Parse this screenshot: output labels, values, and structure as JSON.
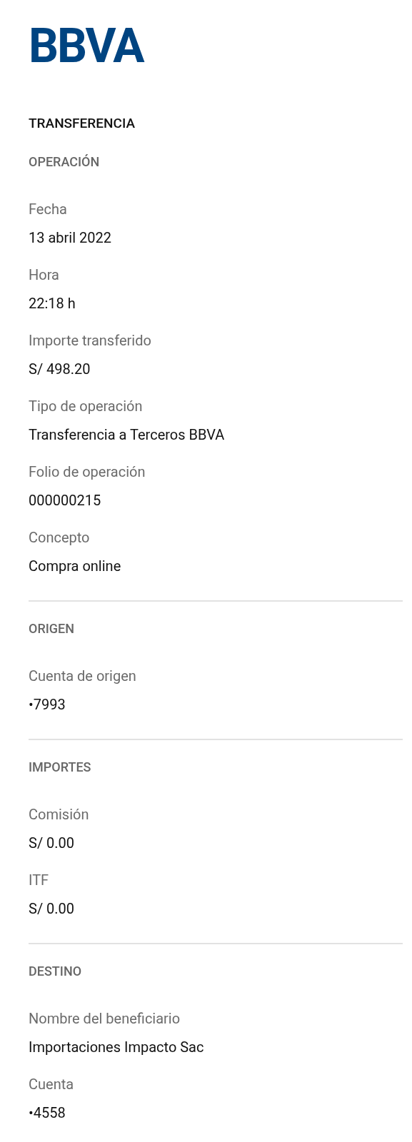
{
  "logo": {
    "text": "BBVA"
  },
  "title": "TRANSFERENCIA",
  "sections": [
    {
      "title": "OPERACIÓN",
      "fields": [
        {
          "label": "Fecha",
          "value": "13 abril 2022"
        },
        {
          "label": "Hora",
          "value": "22:18 h"
        },
        {
          "label": "Importe transferido",
          "value": "S/ 498.20"
        },
        {
          "label": "Tipo de operación",
          "value": "Transferencia a Terceros BBVA"
        },
        {
          "label": "Folio de operación",
          "value": "000000215"
        },
        {
          "label": "Concepto",
          "value": "Compra online"
        }
      ]
    },
    {
      "title": "ORIGEN",
      "fields": [
        {
          "label": "Cuenta de origen",
          "value": "•7993"
        }
      ]
    },
    {
      "title": "IMPORTES",
      "fields": [
        {
          "label": "Comisión",
          "value": "S/ 0.00"
        },
        {
          "label": "ITF",
          "value": "S/ 0.00"
        }
      ]
    },
    {
      "title": "DESTINO",
      "fields": [
        {
          "label": "Nombre del beneficiario",
          "value": "Importaciones Impacto Sac"
        },
        {
          "label": "Cuenta",
          "value": "•4558"
        }
      ]
    }
  ]
}
